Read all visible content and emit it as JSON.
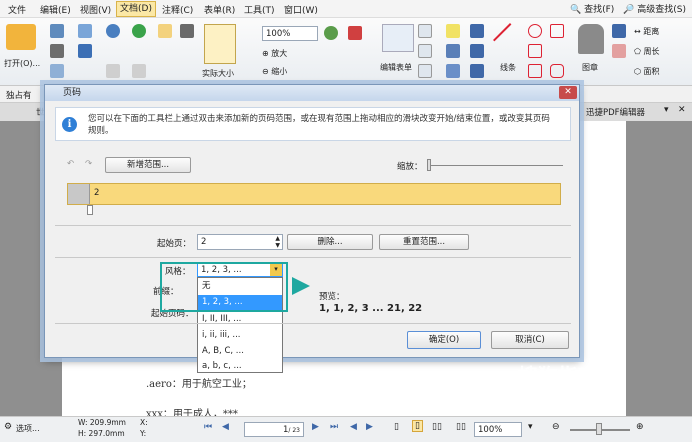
{
  "menu": [
    "文件",
    "编辑(E)",
    "视图(V)",
    "文档(D)",
    "注释(C)",
    "表单(R)",
    "工具(T)",
    "窗口(W)"
  ],
  "active_menu": "文档(D)",
  "search": {
    "find": "查找(F)",
    "advanced": "高级查找(S)"
  },
  "ribbon": {
    "open": "打开(O)...",
    "actual_size": "实际大小",
    "zoom_value": "100%",
    "zoom_in": "放大",
    "zoom_out": "缩小",
    "form_edit": "编辑表单",
    "lines": "线条",
    "figure": "图章",
    "distance": "距离",
    "perimeter": "周长",
    "area": "面积"
  },
  "toolbar2": {
    "label": "独占有"
  },
  "tab": {
    "doc_tab": "世",
    "right_tab": "迅捷PDF编辑器"
  },
  "doc_text": [
    ".aero：用于航空工业；",
    "xxx：用于成人，***"
  ],
  "dialog": {
    "title": "页码",
    "close": "✕",
    "info": "您可以在下面的工具栏上通过双击来添加新的页码范围，或在现有范围上拖动相应的滑块改变开始/结束位置，或改变其页码规则。",
    "add_range": "新增范围...",
    "zoom_label": "缩放：",
    "range_label": "2",
    "start_page_label": "起始页：",
    "start_page_value": "2",
    "delete": "删除...",
    "reset": "重置范围...",
    "style_label": "风格：",
    "style_value": "1, 2, 3, ...",
    "prefix_label": "前缀：",
    "start_num_label": "起始页码：",
    "preview_label": "预览：",
    "preview_value": "1, 1, 2, 3 ... 21, 22",
    "ok": "确定(O)",
    "cancel": "取消(C)",
    "options": [
      "无",
      "1, 2, 3, ...",
      "I, II, III, ...",
      "i, ii, iii, ...",
      "A, B, C, ...",
      "a, b, c, ..."
    ],
    "selected_option": 1
  },
  "status": {
    "options": "选项...",
    "width": "W: 209.9mm",
    "height": "H: 297.0mm",
    "x": "X:",
    "y": "Y:",
    "page": "1",
    "page_total": "/ 23",
    "zoom": "100%"
  },
  "watermark": {
    "main": "搜狗指南",
    "sub": "zhinan.sogou.com"
  }
}
